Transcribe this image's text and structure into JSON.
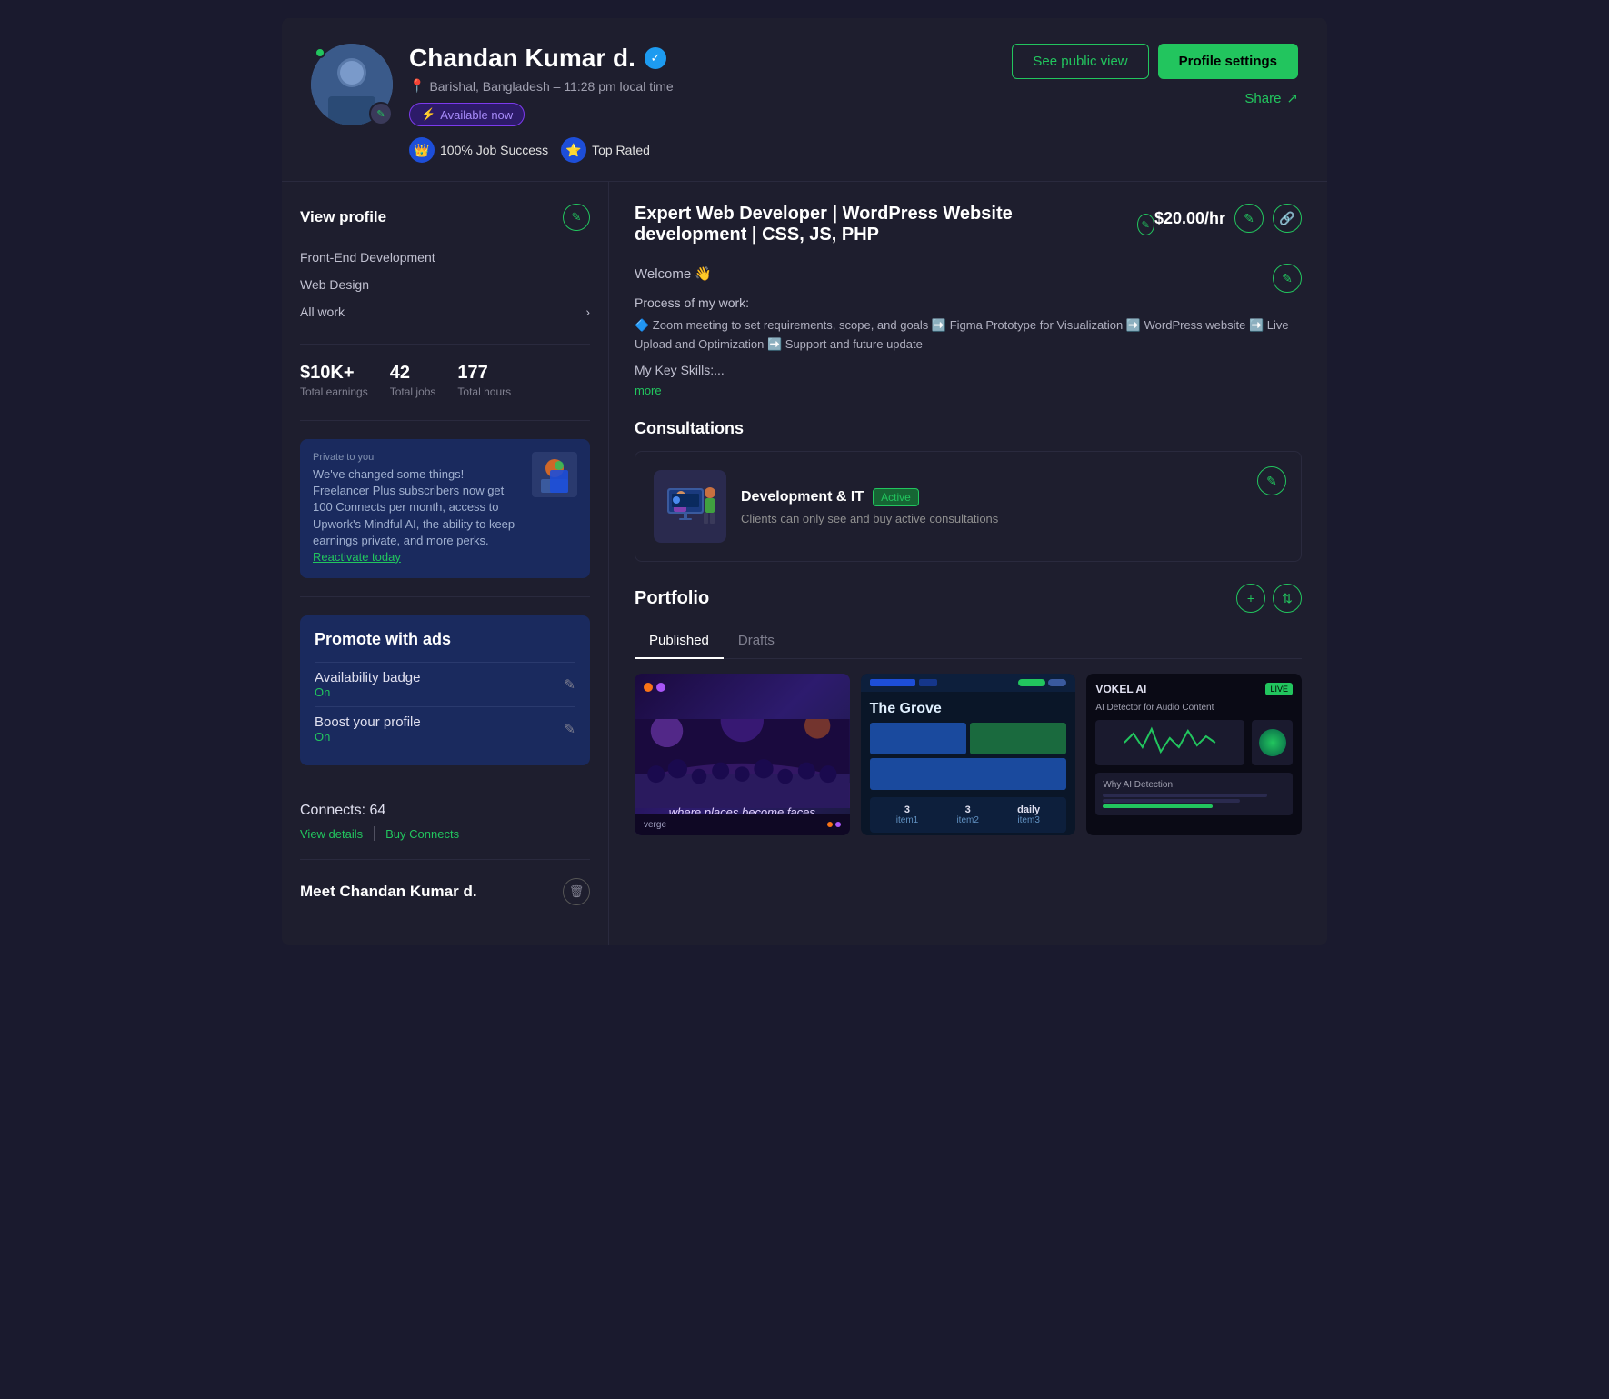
{
  "header": {
    "name": "Chandan Kumar d.",
    "location": "Barishal, Bangladesh – 11:28 pm local time",
    "availability": "Available now",
    "job_success": "100% Job Success",
    "top_rated": "Top Rated",
    "see_public_view": "See public view",
    "profile_settings": "Profile settings",
    "share": "Share"
  },
  "sidebar": {
    "view_profile": "View profile",
    "links": [
      "Front-End Development",
      "Web Design"
    ],
    "all_work": "All work",
    "stats": {
      "earnings": "$10K+",
      "earnings_label": "Total earnings",
      "jobs": "42",
      "jobs_label": "Total jobs",
      "hours": "177",
      "hours_label": "Total hours"
    },
    "private_notice": {
      "label": "Private to you",
      "body": "We've changed some things! Freelancer Plus subscribers now get 100 Connects per month, access to Upwork's Mindful AI, the ability to keep earnings private, and more perks.",
      "link_text": "Reactivate today"
    },
    "promote": {
      "title": "Promote with ads",
      "availability_badge": "Availability badge",
      "availability_status": "On",
      "boost_profile": "Boost your profile",
      "boost_status": "On"
    },
    "connects": {
      "label": "Connects: 64",
      "view_details": "View details",
      "buy_connects": "Buy Connects"
    },
    "meet": "Meet Chandan Kumar d."
  },
  "main": {
    "title": "Expert Web Developer | WordPress Website development | CSS, JS, PHP",
    "rate": "$20.00/hr",
    "bio": {
      "welcome": "Welcome 👋",
      "process_label": "Process of my work:",
      "steps": "🔷 Zoom meeting to set requirements, scope, and goals ➡️ Figma Prototype for Visualization ➡️ WordPress website ➡️ Live Upload and Optimization ➡️ Support and future update",
      "skills_label": "My Key Skills:...",
      "more": "more"
    },
    "consultations": {
      "title": "Consultations",
      "card": {
        "name": "Development & IT",
        "status": "Active",
        "description": "Clients can only see and buy active consultations"
      }
    },
    "portfolio": {
      "title": "Portfolio",
      "tabs": [
        "Published",
        "Drafts"
      ],
      "active_tab": "Published",
      "items": [
        {
          "id": 1,
          "type": "verge",
          "text": "where places become faces"
        },
        {
          "id": 2,
          "type": "grove",
          "title": "The Grove"
        },
        {
          "id": 3,
          "type": "vokel",
          "title": "VOKEL AI",
          "subtitle": "AI Detector for Audio Content"
        }
      ]
    }
  },
  "icons": {
    "edit": "✎",
    "pencil": "✏",
    "location_pin": "📍",
    "verified": "✓",
    "crown": "👑",
    "star": "⭐",
    "share_arrow": "↗",
    "chevron_right": "›",
    "plus": "+",
    "sort": "⇅",
    "trash": "🗑",
    "link": "🔗"
  }
}
